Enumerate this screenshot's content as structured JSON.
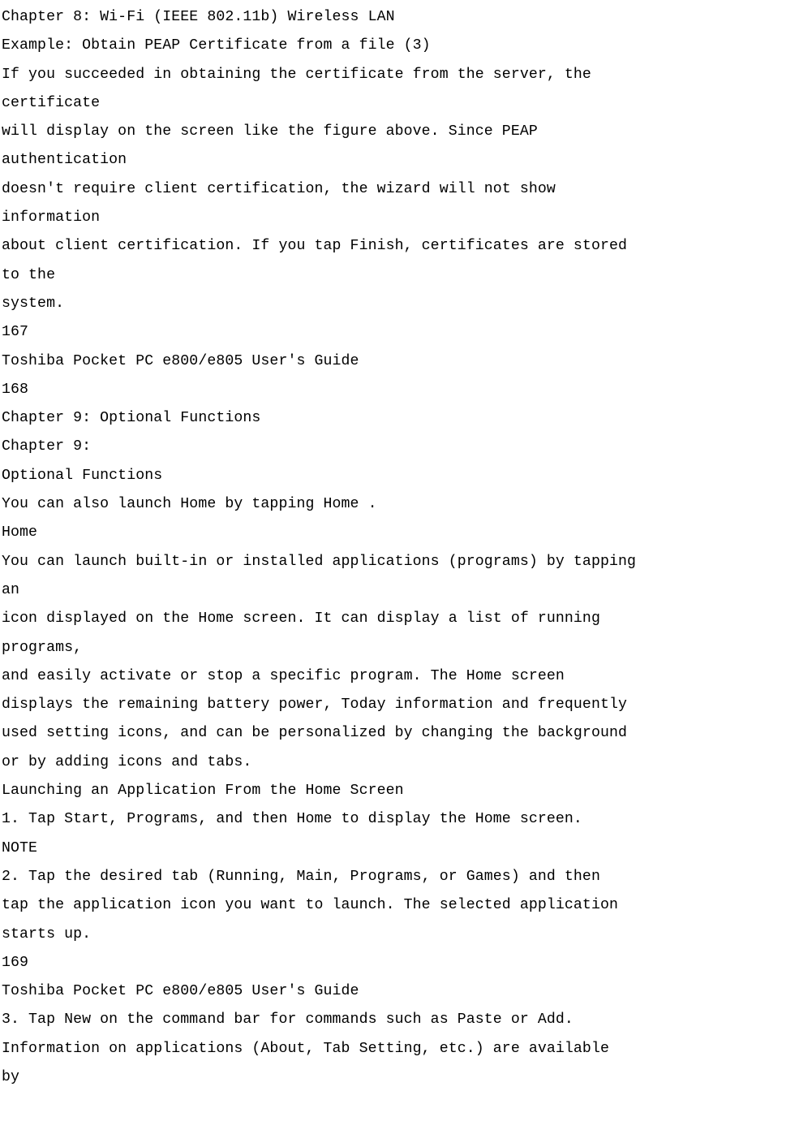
{
  "lines": [
    "Chapter 8: Wi-Fi (IEEE 802.11b) Wireless LAN",
    "Example: Obtain PEAP Certificate from a file (3)",
    "If you succeeded in obtaining the certificate from the server, the",
    "certificate",
    "will display on the screen like the figure above. Since PEAP",
    "authentication",
    "doesn't require client certification, the wizard will not show",
    "information",
    "about client certification. If you tap Finish, certificates are stored",
    "to the",
    "system.",
    "167",
    "Toshiba Pocket PC e800/e805 User's Guide",
    "168",
    "Chapter 9: Optional Functions",
    "Chapter 9:",
    "Optional Functions",
    "You can also launch Home by tapping Home .",
    "Home",
    "You can launch built-in or installed applications (programs) by tapping",
    "an",
    "icon displayed on the Home screen. It can display a list of running",
    "programs,",
    "and easily activate or stop a specific program. The Home screen",
    "displays the remaining battery power, Today information and frequently",
    "used setting icons, and can be personalized by changing the background",
    "or by adding icons and tabs.",
    "Launching an Application From the Home Screen",
    "1. Tap Start, Programs, and then Home to display the Home screen.",
    "NOTE",
    "2. Tap the desired tab (Running, Main, Programs, or Games) and then",
    "tap the application icon you want to launch. The selected application",
    "starts up.",
    "169",
    "Toshiba Pocket PC e800/e805 User's Guide",
    "3. Tap New on the command bar for commands such as Paste or Add.",
    "Information on applications (About, Tab Setting, etc.) are available",
    "by"
  ]
}
